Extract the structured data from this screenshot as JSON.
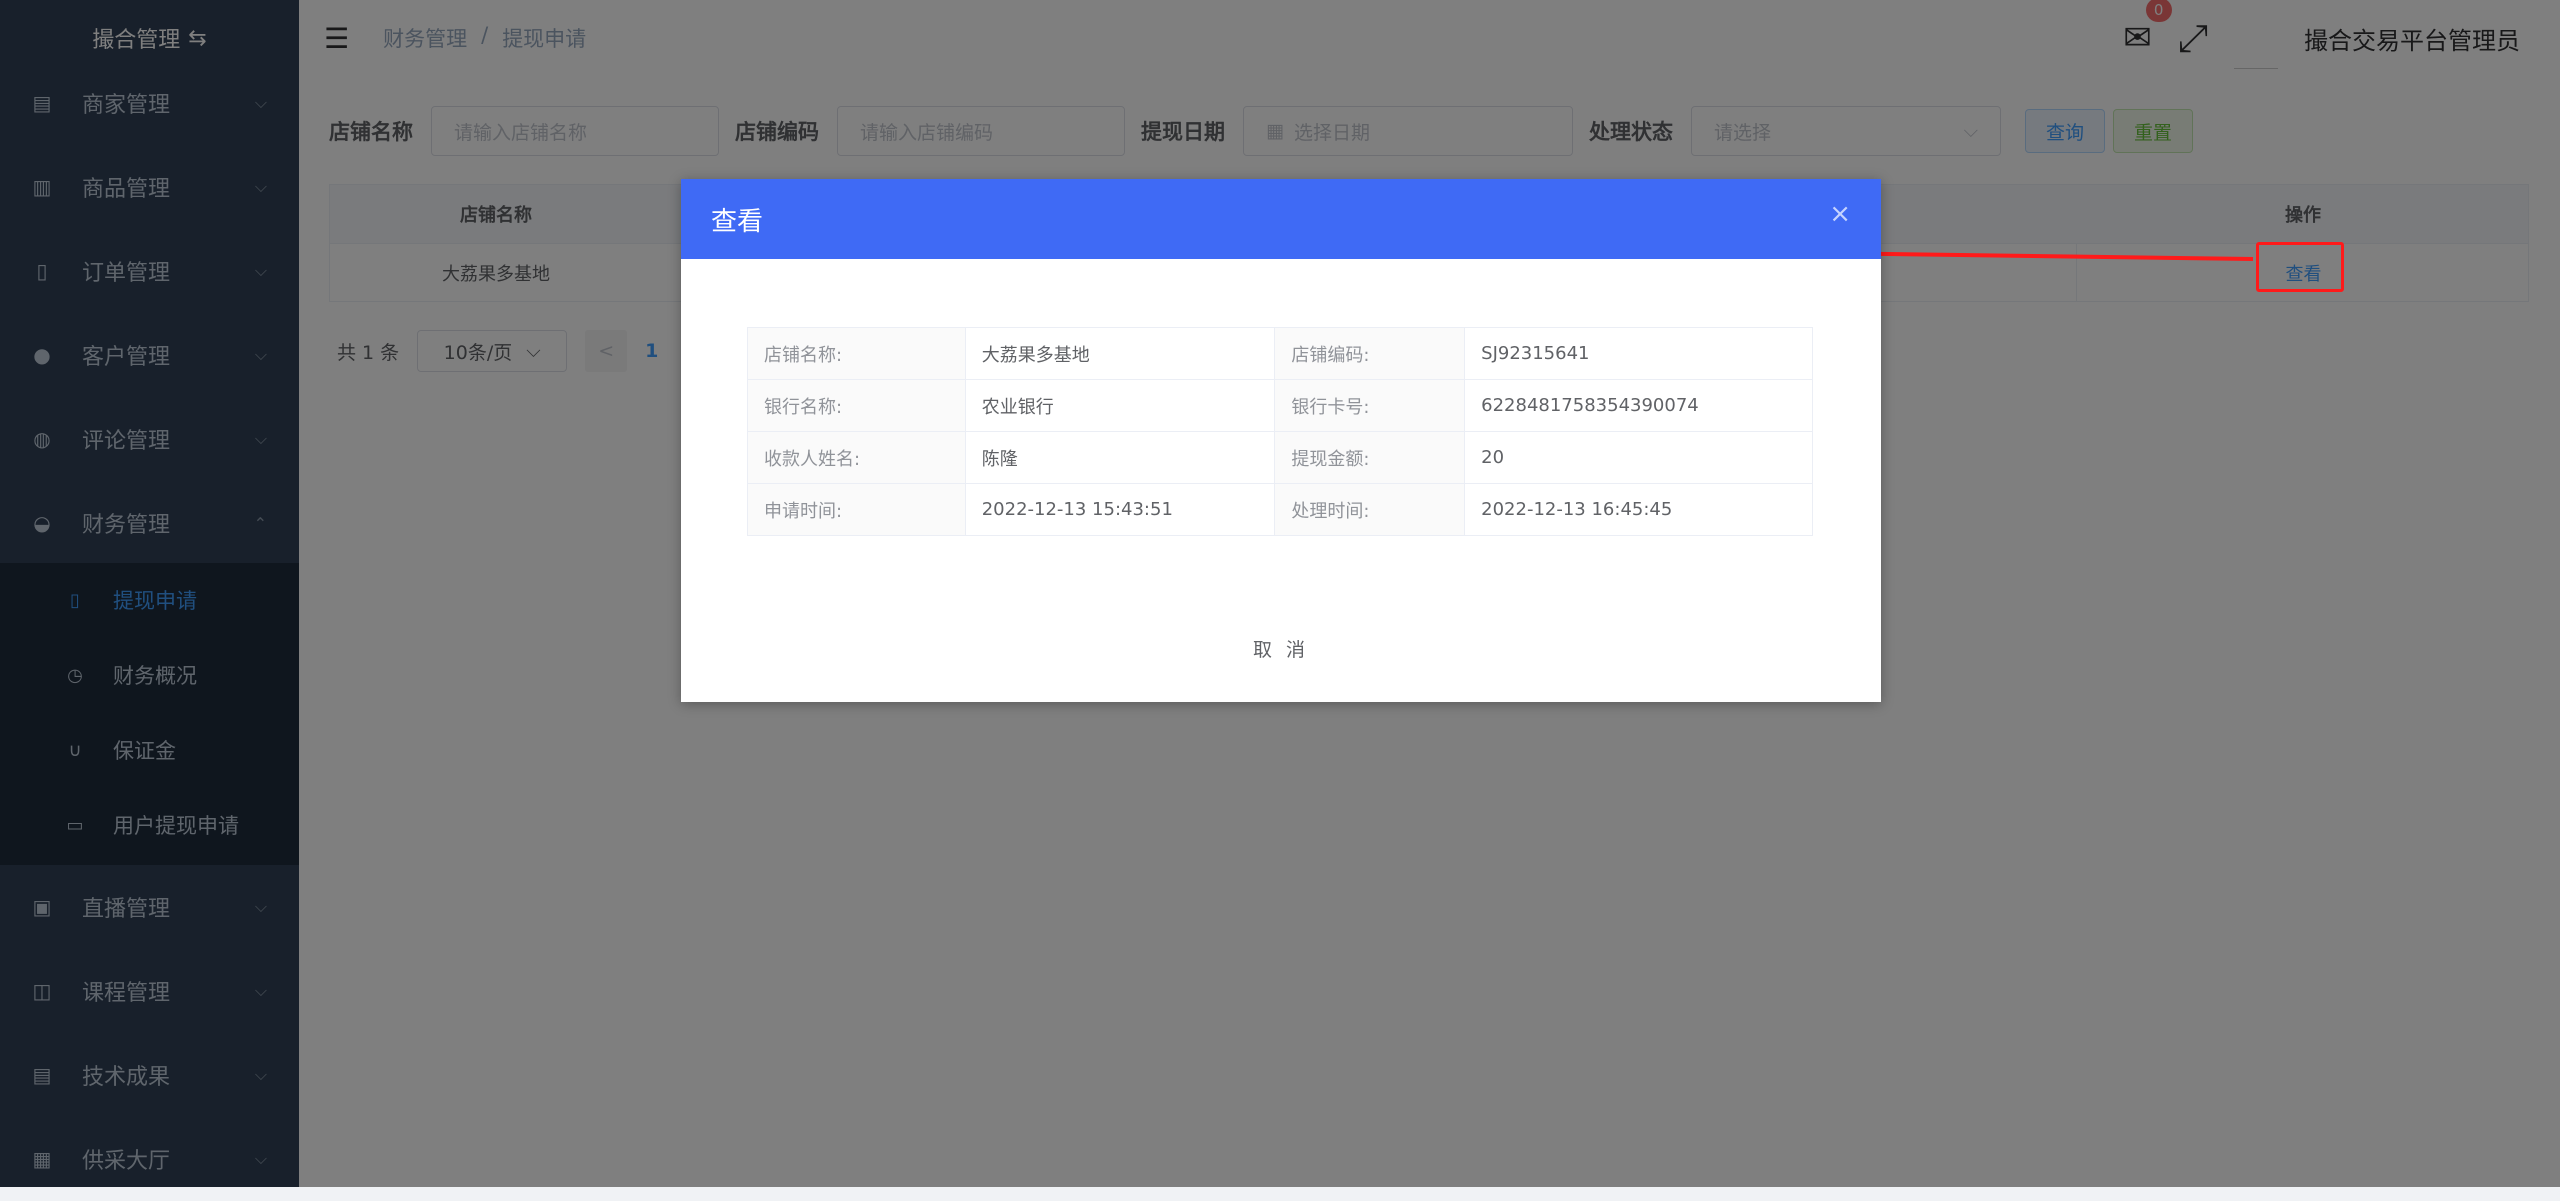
{
  "sidebar": {
    "logo": "撮合管理",
    "items": [
      {
        "label": "商家管理",
        "icon": "store-icon"
      },
      {
        "label": "商品管理",
        "icon": "gift-icon"
      },
      {
        "label": "订单管理",
        "icon": "document-icon"
      },
      {
        "label": "客户管理",
        "icon": "user-icon"
      },
      {
        "label": "评论管理",
        "icon": "comment-icon"
      },
      {
        "label": "财务管理",
        "icon": "finance-icon"
      }
    ],
    "sub_items": [
      {
        "label": "提现申请",
        "icon": "withdraw-icon"
      },
      {
        "label": "财务概况",
        "icon": "dashboard-icon"
      },
      {
        "label": "保证金",
        "icon": "magnet-icon"
      },
      {
        "label": "用户提现申请",
        "icon": "card-icon"
      }
    ],
    "lower_items": [
      {
        "label": "直播管理",
        "icon": "live-icon"
      },
      {
        "label": "课程管理",
        "icon": "book-icon"
      },
      {
        "label": "技术成果",
        "icon": "report-icon"
      },
      {
        "label": "供采大厅",
        "icon": "building-icon"
      }
    ]
  },
  "header": {
    "breadcrumb": [
      "财务管理",
      "提现申请"
    ],
    "separator": "/",
    "mail_badge": "0",
    "admin_name": "撮合交易平台管理员"
  },
  "filters": {
    "store_name_label": "店铺名称",
    "store_name_placeholder": "请输入店铺名称",
    "store_code_label": "店铺编码",
    "store_code_placeholder": "请输入店铺编码",
    "date_label": "提现日期",
    "date_placeholder": "选择日期",
    "status_label": "处理状态",
    "status_placeholder": "请选择",
    "query_label": "查询",
    "reset_label": "重置"
  },
  "table": {
    "headers": {
      "name": "店铺名称",
      "op": "操作"
    },
    "rows": [
      {
        "name": "大荔果多基地",
        "op": "查看"
      }
    ]
  },
  "pager": {
    "total": "共 1 条",
    "page_size": "10条/页",
    "prev": "<",
    "current": "1"
  },
  "dialog": {
    "title": "查看",
    "close": "×",
    "fields": [
      [
        {
          "label": "店铺名称:",
          "value": "大荔果多基地"
        },
        {
          "label": "店铺编码:",
          "value": "SJ92315641"
        }
      ],
      [
        {
          "label": "银行名称:",
          "value": "农业银行"
        },
        {
          "label": "银行卡号:",
          "value": "6228481758354390074"
        }
      ],
      [
        {
          "label": "收款人姓名:",
          "value": "陈隆"
        },
        {
          "label": "提现金额:",
          "value": "20"
        }
      ],
      [
        {
          "label": "申请时间:",
          "value": "2022-12-13 15:43:51"
        },
        {
          "label": "处理时间:",
          "value": "2022-12-13 16:45:45"
        }
      ]
    ],
    "cancel": "取 消"
  },
  "colors": {
    "sidebar_bg": "#304156",
    "submenu_bg": "#1f2d3d",
    "accent": "#409eff",
    "dialog_header": "#3f6af5",
    "annotation_red": "#ff1a1a"
  }
}
